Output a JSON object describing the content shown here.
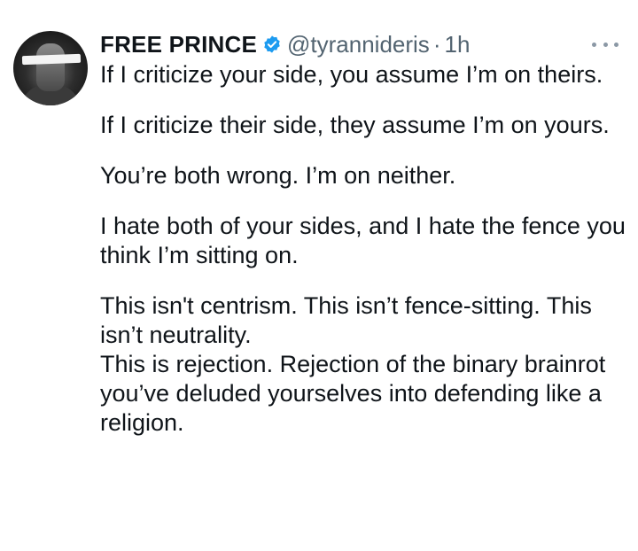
{
  "author": {
    "name": "FREE PRINCE",
    "handle": "@tyrannideris",
    "separator": "·",
    "time": "1h",
    "verified_badge": "verified-badge-icon"
  },
  "tweet": {
    "paragraphs": [
      "If I criticize your side, you assume I’m on theirs.",
      "If I criticize their side, they assume I’m on yours.",
      "You’re both wrong. I’m on neither.",
      "I hate both of your sides, and I hate the fence you think I’m sitting on.",
      "This isn't centrism. This isn’t fence-sitting. This isn’t neutrality.",
      "This is rejection. Rejection of the binary brainrot you’ve deluded yourselves into defending like a religion."
    ]
  },
  "colors": {
    "text": "#0f1419",
    "secondary": "#536471",
    "verified": "#1d9bf0",
    "background": "#ffffff"
  }
}
